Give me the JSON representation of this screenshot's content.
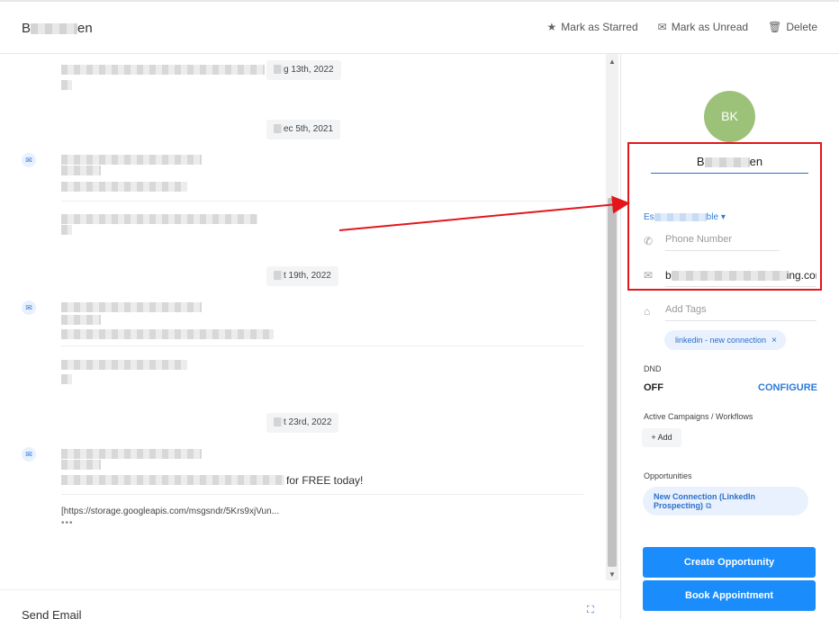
{
  "header": {
    "contact_name_prefix": "B",
    "contact_name_suffix": "en",
    "actions": [
      {
        "label": "Mark as Starred",
        "icon": "star-icon"
      },
      {
        "label": "Mark as Unread",
        "icon": "envelope-icon"
      },
      {
        "label": "Delete",
        "icon": "trash-icon"
      }
    ]
  },
  "conversation": {
    "dates": [
      {
        "suffix": "g 13th, 2022"
      },
      {
        "suffix": "ec 5th, 2021"
      },
      {
        "suffix": "t 19th, 2022"
      },
      {
        "suffix": "t 23rd, 2022"
      }
    ],
    "visible_text": "for FREE today!",
    "link": "[https://storage.googleapis.com/msgsndr/5Krs9xjVun...",
    "more": "•••"
  },
  "send_bar": {
    "label": "Send Email"
  },
  "contact_panel": {
    "avatar_initials": "BK",
    "name_prefix": "B",
    "name_suffix": "en",
    "timezone_prefix": "Es",
    "timezone_suffix": "ble",
    "phone_placeholder": "Phone Number",
    "email_prefix": "b",
    "email_suffix": "ing.com",
    "tags_placeholder": "Add Tags",
    "tag": "linkedin - new connection",
    "dnd_label": "DND",
    "dnd_value": "OFF",
    "configure_label": "CONFIGURE",
    "campaigns_label": "Active Campaigns / Workflows",
    "add_label": "Add",
    "opportunities_label": "Opportunities",
    "opportunity": "New Connection (LinkedIn Prospecting)",
    "create_opportunity": "Create Opportunity",
    "book_appointment": "Book Appointment"
  },
  "colors": {
    "accent": "#1a8cfb",
    "link": "#2e7ad9",
    "avatar": "#9cc27a",
    "highlight_box": "#e3161b"
  }
}
